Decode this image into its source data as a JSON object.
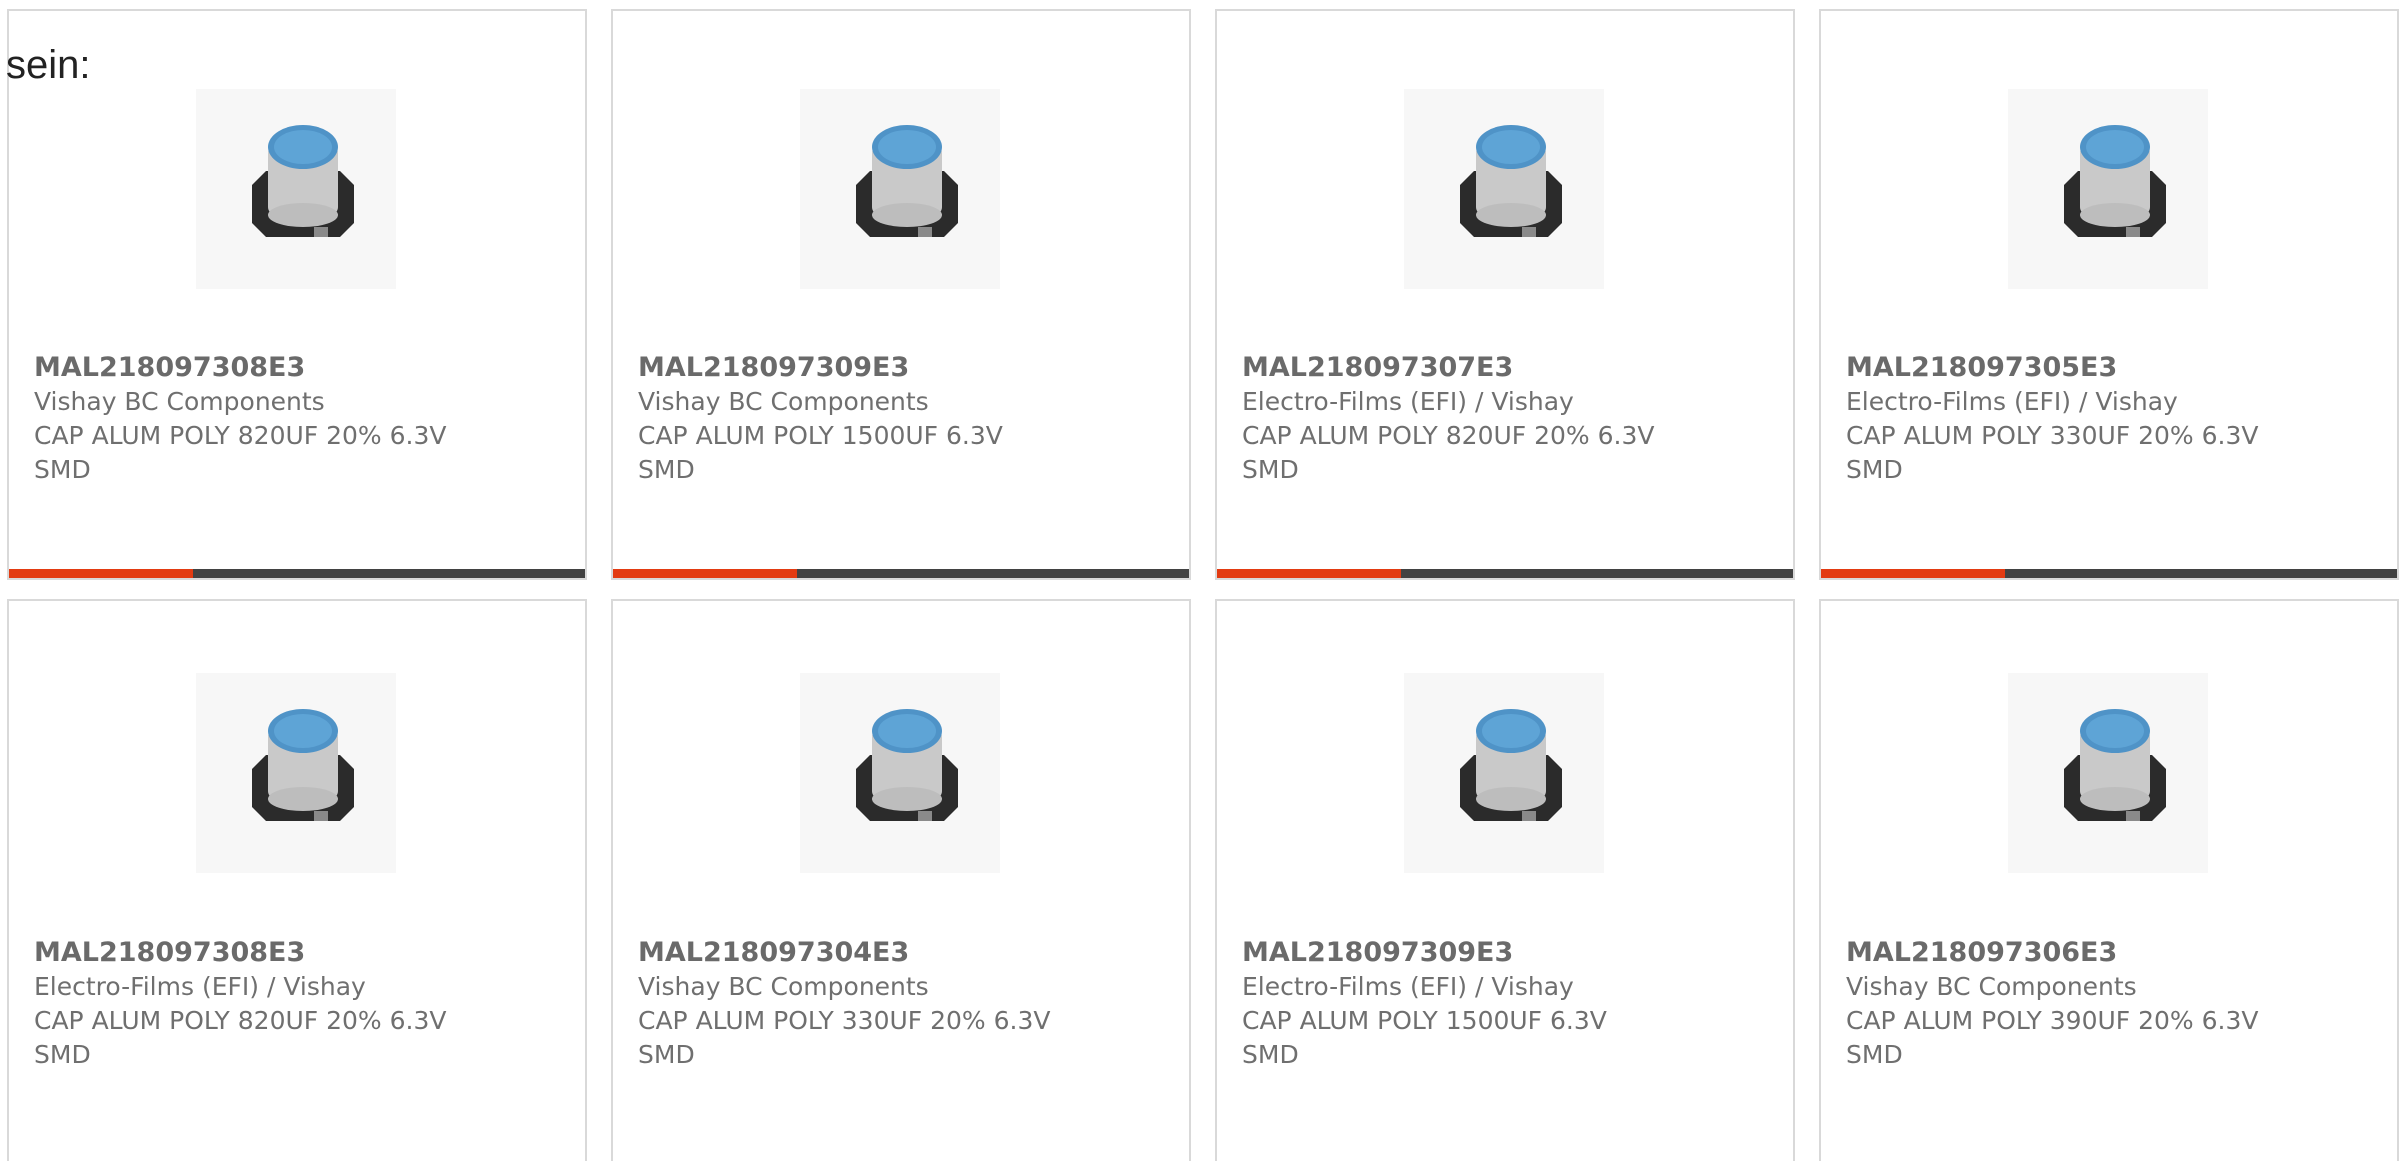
{
  "intro_text": "sein:",
  "colors": {
    "accent": "#e33b12",
    "bar_track": "#424242",
    "card_border": "#d9d9d9",
    "text": "#6f6f6f",
    "capacitor_top": "#4f93c7",
    "capacitor_body": "#c9c9c9",
    "capacitor_base": "#2b2b2b"
  },
  "products": [
    {
      "part_number": "MAL218097308E3",
      "manufacturer": "Vishay BC Components",
      "description": "CAP ALUM POLY 820UF 20% 6.3V",
      "package": "SMD",
      "image_icon": "smd-capacitor-icon"
    },
    {
      "part_number": "MAL218097309E3",
      "manufacturer": "Vishay BC Components",
      "description": "CAP ALUM POLY 1500UF 6.3V",
      "package": "SMD",
      "image_icon": "smd-capacitor-icon"
    },
    {
      "part_number": "MAL218097307E3",
      "manufacturer": "Electro-Films (EFI) / Vishay",
      "description": "CAP ALUM POLY 820UF 20% 6.3V",
      "package": "SMD",
      "image_icon": "smd-capacitor-icon"
    },
    {
      "part_number": "MAL218097305E3",
      "manufacturer": "Electro-Films (EFI) / Vishay",
      "description": "CAP ALUM POLY 330UF 20% 6.3V",
      "package": "SMD",
      "image_icon": "smd-capacitor-icon"
    },
    {
      "part_number": "MAL218097308E3",
      "manufacturer": "Electro-Films (EFI) / Vishay",
      "description": "CAP ALUM POLY 820UF 20% 6.3V",
      "package": "SMD",
      "image_icon": "smd-capacitor-icon"
    },
    {
      "part_number": "MAL218097304E3",
      "manufacturer": "Vishay BC Components",
      "description": "CAP ALUM POLY 330UF 20% 6.3V",
      "package": "SMD",
      "image_icon": "smd-capacitor-icon"
    },
    {
      "part_number": "MAL218097309E3",
      "manufacturer": "Electro-Films (EFI) / Vishay",
      "description": "CAP ALUM POLY 1500UF 6.3V",
      "package": "SMD",
      "image_icon": "smd-capacitor-icon"
    },
    {
      "part_number": "MAL218097306E3",
      "manufacturer": "Vishay BC Components",
      "description": "CAP ALUM POLY 390UF 20% 6.3V",
      "package": "SMD",
      "image_icon": "smd-capacitor-icon"
    }
  ],
  "carousel": {
    "progress_fraction": 0.32
  }
}
